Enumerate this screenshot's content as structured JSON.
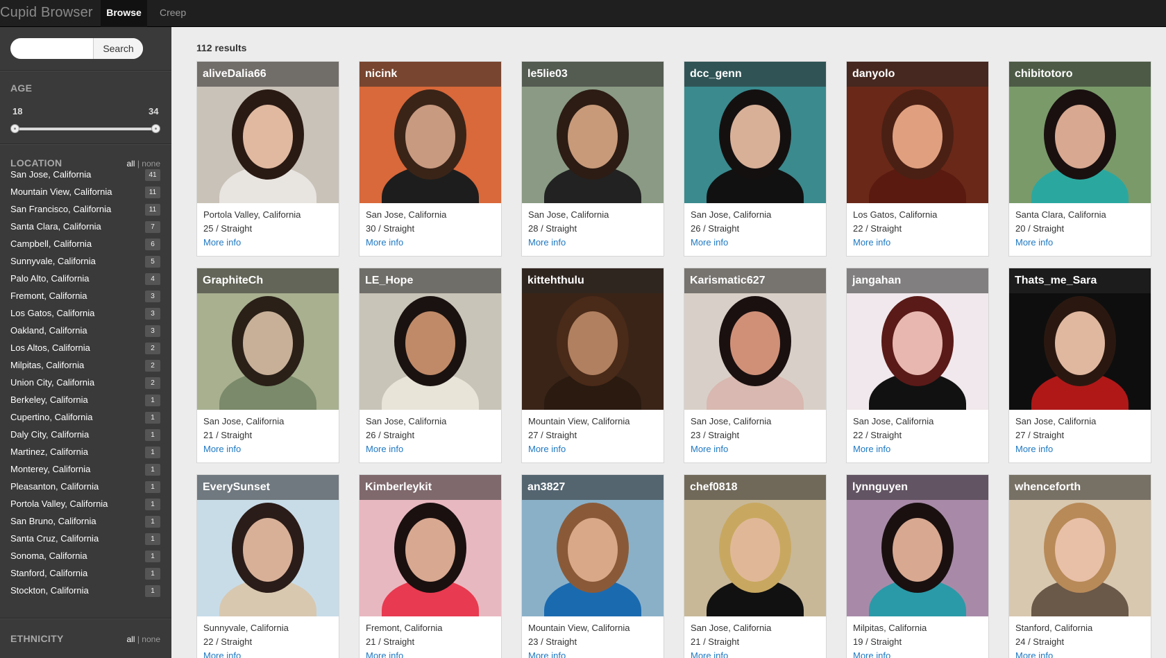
{
  "app": {
    "brand": "Cupid Browser",
    "tabs": [
      {
        "label": "Browse",
        "active": true
      },
      {
        "label": "Creep",
        "active": false
      }
    ]
  },
  "sidebar": {
    "search": {
      "placeholder": "",
      "value": "",
      "button_label": "Search"
    },
    "age": {
      "heading": "AGE",
      "min": "18",
      "max": "34"
    },
    "location": {
      "heading": "LOCATION",
      "all_label": "all",
      "separator": "|",
      "none_label": "none",
      "items": [
        {
          "name": "San Jose, California",
          "count": "41"
        },
        {
          "name": "Mountain View, California",
          "count": "11"
        },
        {
          "name": "San Francisco, California",
          "count": "11"
        },
        {
          "name": "Santa Clara, California",
          "count": "7"
        },
        {
          "name": "Campbell, California",
          "count": "6"
        },
        {
          "name": "Sunnyvale, California",
          "count": "5"
        },
        {
          "name": "Palo Alto, California",
          "count": "4"
        },
        {
          "name": "Fremont, California",
          "count": "3"
        },
        {
          "name": "Los Gatos, California",
          "count": "3"
        },
        {
          "name": "Oakland, California",
          "count": "3"
        },
        {
          "name": "Los Altos, California",
          "count": "2"
        },
        {
          "name": "Milpitas, California",
          "count": "2"
        },
        {
          "name": "Union City, California",
          "count": "2"
        },
        {
          "name": "Berkeley, California",
          "count": "1"
        },
        {
          "name": "Cupertino, California",
          "count": "1"
        },
        {
          "name": "Daly City, California",
          "count": "1"
        },
        {
          "name": "Martinez, California",
          "count": "1"
        },
        {
          "name": "Monterey, California",
          "count": "1"
        },
        {
          "name": "Pleasanton, California",
          "count": "1"
        },
        {
          "name": "Portola Valley, California",
          "count": "1"
        },
        {
          "name": "San Bruno, California",
          "count": "1"
        },
        {
          "name": "Santa Cruz, California",
          "count": "1"
        },
        {
          "name": "Sonoma, California",
          "count": "1"
        },
        {
          "name": "Stanford, California",
          "count": "1"
        },
        {
          "name": "Stockton, California",
          "count": "1"
        }
      ]
    },
    "ethnicity": {
      "heading": "ETHNICITY",
      "all_label": "all",
      "separator": "|",
      "none_label": "none"
    }
  },
  "main": {
    "results_label": "112 results",
    "more_info_label": "More info",
    "profiles": [
      {
        "username": "aliveDalia66",
        "location": "Portola Valley, California",
        "age_orientation": "25 / Straight",
        "bg": "#c9c2b8",
        "hair": "#2a1a14",
        "skin": "#e0b9a0",
        "shirt": "#e8e4e0"
      },
      {
        "username": "nicink",
        "location": "San Jose, California",
        "age_orientation": "30 / Straight",
        "bg": "#d9683a",
        "hair": "#3a2418",
        "skin": "#c89a80",
        "shirt": "#1d1d1d"
      },
      {
        "username": "le5lie03",
        "location": "San Jose, California",
        "age_orientation": "28 / Straight",
        "bg": "#8a9a84",
        "hair": "#2c1c14",
        "skin": "#c89a7a",
        "shirt": "#222222"
      },
      {
        "username": "dcc_genn",
        "location": "San Jose, California",
        "age_orientation": "26 / Straight",
        "bg": "#3a8a8e",
        "hair": "#151010",
        "skin": "#d8b098",
        "shirt": "#111111"
      },
      {
        "username": "danyolo",
        "location": "Los Gatos, California",
        "age_orientation": "22 / Straight",
        "bg": "#6a2818",
        "hair": "#4a2014",
        "skin": "#e0a080",
        "shirt": "#5a1a10"
      },
      {
        "username": "chibitotoro",
        "location": "Santa Clara, California",
        "age_orientation": "20 / Straight",
        "bg": "#7a9a6a",
        "hair": "#1a1010",
        "skin": "#d8a890",
        "shirt": "#2aa8a0"
      },
      {
        "username": "GraphiteCh",
        "location": "San Jose, California",
        "age_orientation": "21 / Straight",
        "bg": "#a8b090",
        "hair": "#2a2018",
        "skin": "#c8b098",
        "shirt": "#7a8a6a"
      },
      {
        "username": "LE_Hope",
        "location": "San Jose, California",
        "age_orientation": "26 / Straight",
        "bg": "#c8c4b8",
        "hair": "#1a1210",
        "skin": "#c08a68",
        "shirt": "#e8e4d8"
      },
      {
        "username": "kittehthulu",
        "location": "Mountain View, California",
        "age_orientation": "27 / Straight",
        "bg": "#3a2418",
        "hair": "#4a2a18",
        "skin": "#b08060",
        "shirt": "#2a1a10"
      },
      {
        "username": "Karismatic627",
        "location": "San Jose, California",
        "age_orientation": "23 / Straight",
        "bg": "#d8d0c8",
        "hair": "#1a1010",
        "skin": "#d09078",
        "shirt": "#d8b8b0"
      },
      {
        "username": "jangahan",
        "location": "San Jose, California",
        "age_orientation": "22 / Straight",
        "bg": "#f0e8ec",
        "hair": "#5a1a18",
        "skin": "#e8b8b0",
        "shirt": "#111111"
      },
      {
        "username": "Thats_me_Sara",
        "location": "San Jose, California",
        "age_orientation": "27 / Straight",
        "bg": "#0e0e0e",
        "hair": "#2a1810",
        "skin": "#e0b8a0",
        "shirt": "#b01818"
      },
      {
        "username": "EverySunset",
        "location": "Sunnyvale, California",
        "age_orientation": "22 / Straight",
        "bg": "#c8dce8",
        "hair": "#2a1c18",
        "skin": "#d8b098",
        "shirt": "#d8c8b0"
      },
      {
        "username": "Kimberleykit",
        "location": "Fremont, California",
        "age_orientation": "21 / Straight",
        "bg": "#e8b8c0",
        "hair": "#1a1010",
        "skin": "#d8a890",
        "shirt": "#e83a50"
      },
      {
        "username": "an3827",
        "location": "Mountain View, California",
        "age_orientation": "23 / Straight",
        "bg": "#8ab0c8",
        "hair": "#8a5a38",
        "skin": "#d8a888",
        "shirt": "#1a6ab0"
      },
      {
        "username": "chef0818",
        "location": "San Jose, California",
        "age_orientation": "21 / Straight",
        "bg": "#c8b898",
        "hair": "#c8a860",
        "skin": "#e0b898",
        "shirt": "#111111"
      },
      {
        "username": "lynnguyen",
        "location": "Milpitas, California",
        "age_orientation": "19 / Straight",
        "bg": "#a88aa8",
        "hair": "#1a1010",
        "skin": "#d8a890",
        "shirt": "#2a9aa8"
      },
      {
        "username": "whenceforth",
        "location": "Stanford, California",
        "age_orientation": "24 / Straight",
        "bg": "#d8c8b0",
        "hair": "#b88a58",
        "skin": "#e8c0a8",
        "shirt": "#6a5848"
      }
    ]
  }
}
